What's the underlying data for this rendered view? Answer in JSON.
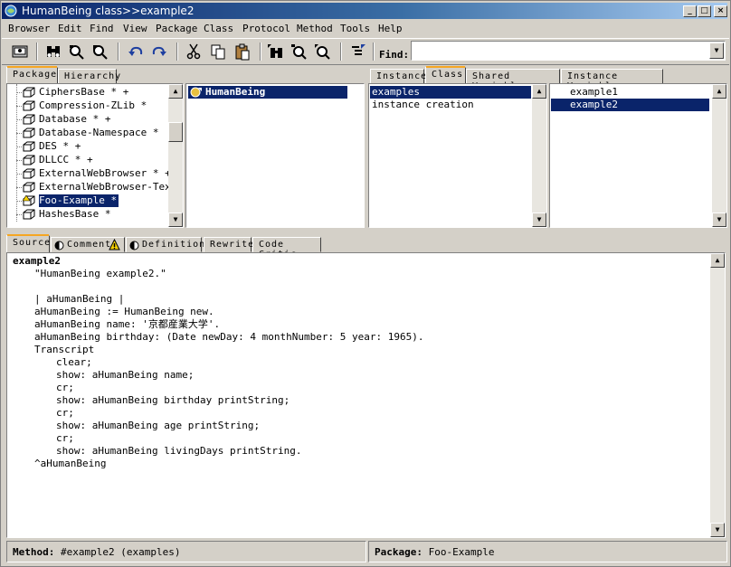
{
  "window": {
    "title": "HumanBeing class>>example2"
  },
  "menu": [
    "Browser",
    "Edit",
    "Find",
    "View",
    "Package",
    "Class",
    "Protocol",
    "Method",
    "Tools",
    "Help"
  ],
  "toolbar": {
    "find_label": "Find:",
    "find_value": ""
  },
  "top_tabs_left": [
    "Package",
    "Hierarchy"
  ],
  "top_tabs_right": [
    "Instance",
    "Class",
    "Shared Variable",
    "Instance Variable"
  ],
  "packages": [
    {
      "label": "CiphersBase * +"
    },
    {
      "label": "Compression-ZLib *"
    },
    {
      "label": "Database * +"
    },
    {
      "label": "Database-Namespace *"
    },
    {
      "label": "DES * +"
    },
    {
      "label": "DLLCC * +"
    },
    {
      "label": "ExternalWebBrowser * +"
    },
    {
      "label": "ExternalWebBrowser-Text"
    },
    {
      "label": "Foo-Example *",
      "selected": true,
      "warning": true
    },
    {
      "label": "HashesBase *"
    }
  ],
  "classes": [
    {
      "label": "HumanBeing",
      "selected": true
    }
  ],
  "protocols": [
    {
      "label": "examples",
      "selected": true
    },
    {
      "label": "instance creation"
    }
  ],
  "methods": [
    {
      "label": "example1"
    },
    {
      "label": "example2",
      "selected": true
    }
  ],
  "bottom_tabs": [
    "Source",
    "Comment",
    "Definition",
    "Rewrite",
    "Code Critic"
  ],
  "source": [
    {
      "text": "example2",
      "bold": true,
      "indent": 0
    },
    {
      "text": "\"HumanBeing example2.\"",
      "indent": 1
    },
    {
      "text": "",
      "indent": 0
    },
    {
      "text": "| aHumanBeing |",
      "indent": 1
    },
    {
      "text": "aHumanBeing := HumanBeing new.",
      "indent": 1
    },
    {
      "text": "aHumanBeing name: '京都産業大学'.",
      "indent": 1
    },
    {
      "text": "aHumanBeing birthday: (Date newDay: 4 monthNumber: 5 year: 1965).",
      "indent": 1
    },
    {
      "text": "Transcript",
      "indent": 1
    },
    {
      "text": "clear;",
      "indent": 2
    },
    {
      "text": "show: aHumanBeing name;",
      "indent": 2
    },
    {
      "text": "cr;",
      "indent": 2
    },
    {
      "text": "show: aHumanBeing birthday printString;",
      "indent": 2
    },
    {
      "text": "cr;",
      "indent": 2
    },
    {
      "text": "show: aHumanBeing age printString;",
      "indent": 2
    },
    {
      "text": "cr;",
      "indent": 2
    },
    {
      "text": "show: aHumanBeing livingDays printString.",
      "indent": 2
    },
    {
      "text": "^aHumanBeing",
      "indent": 1
    }
  ],
  "status": {
    "method_label": "Method:",
    "method_value": "#example2 (examples)",
    "package_label": "Package:",
    "package_value": "Foo-Example"
  },
  "colors": {
    "selection": "#0a246a",
    "tab_highlight": "#f5a623"
  }
}
